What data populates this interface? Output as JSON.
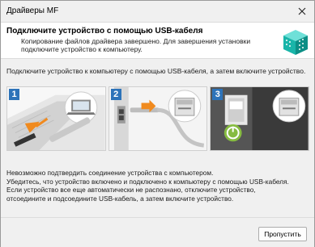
{
  "window": {
    "title": "Драйверы MF"
  },
  "header": {
    "title": "Подключите устройство с помощью USB-кабеля",
    "subtitle": "Копирование файлов драйвера завершено. Для завершения установки подключите устройство к компьютеру.",
    "icon": "driver-box-icon"
  },
  "instruction": "Подключите устройство к компьютеру с помощью USB-кабеля, а затем включите устройство.",
  "steps": [
    {
      "number": "1",
      "icon": "laptop-usb-port-icon"
    },
    {
      "number": "2",
      "icon": "printer-usb-port-icon"
    },
    {
      "number": "3",
      "icon": "power-button-icon"
    }
  ],
  "message": {
    "line1": "Невозможно подтвердить соединение устройства с компьютером.",
    "line2": "Убедитесь, что устройство включено и подключено к компьютеру с помощью USB-кабеля.",
    "line3": "Если устройство все еще автоматически не распознано, отключите устройство,",
    "line4": "отсоедините и подсоедините USB-кабель, а затем включите устройство."
  },
  "footer": {
    "skip_label": "Пропустить"
  },
  "colors": {
    "step_badge": "#2d73b9",
    "arrow": "#f08a1e",
    "power_glow": "#8cc63f"
  }
}
